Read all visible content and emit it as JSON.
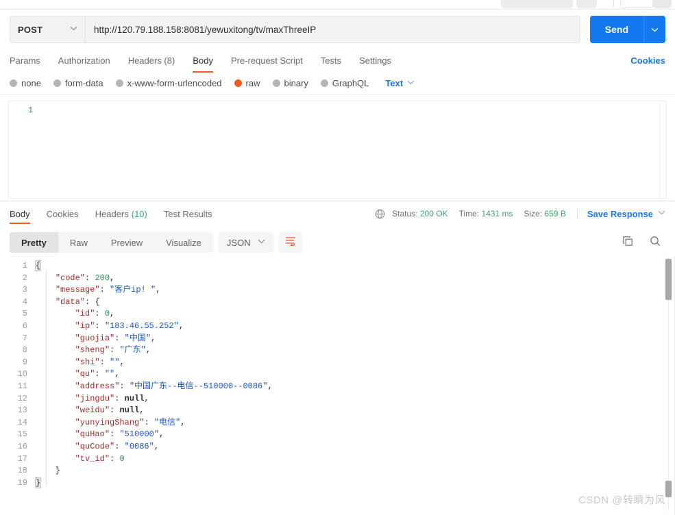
{
  "request": {
    "method": "POST",
    "url": "http://120.79.188.158:8081/yewuxitong/tv/maxThreeIP",
    "send_label": "Send",
    "tabs": [
      {
        "label": "Params",
        "active": false
      },
      {
        "label": "Authorization",
        "active": false
      },
      {
        "label": "Headers (8)",
        "active": false
      },
      {
        "label": "Body",
        "active": true
      },
      {
        "label": "Pre-request Script",
        "active": false
      },
      {
        "label": "Tests",
        "active": false
      },
      {
        "label": "Settings",
        "active": false
      }
    ],
    "cookies_label": "Cookies",
    "body_types": [
      {
        "label": "none",
        "selected": false
      },
      {
        "label": "form-data",
        "selected": false
      },
      {
        "label": "x-www-form-urlencoded",
        "selected": false
      },
      {
        "label": "raw",
        "selected": true
      },
      {
        "label": "binary",
        "selected": false
      },
      {
        "label": "GraphQL",
        "selected": false
      }
    ],
    "raw_format": "Text",
    "editor_line_number": "1",
    "editor_value": ""
  },
  "response": {
    "tabs": [
      {
        "label": "Body",
        "count": "",
        "active": true
      },
      {
        "label": "Cookies",
        "count": "",
        "active": false
      },
      {
        "label": "Headers",
        "count": "(10)",
        "active": false
      },
      {
        "label": "Test Results",
        "count": "",
        "active": false
      }
    ],
    "status_label": "Status:",
    "status_value": "200 OK",
    "time_label": "Time:",
    "time_value": "1431 ms",
    "size_label": "Size:",
    "size_value": "659 B",
    "save_response_label": "Save Response",
    "view_modes": [
      {
        "label": "Pretty",
        "active": true
      },
      {
        "label": "Raw",
        "active": false
      },
      {
        "label": "Preview",
        "active": false
      },
      {
        "label": "Visualize",
        "active": false
      }
    ],
    "format": "JSON",
    "lines": [
      {
        "n": "1",
        "indent": 0,
        "tokens": [
          {
            "t": "brace",
            "v": "{"
          }
        ]
      },
      {
        "n": "2",
        "indent": 1,
        "tokens": [
          {
            "t": "k",
            "v": "\"code\""
          },
          {
            "t": "p",
            "v": ": "
          },
          {
            "t": "n",
            "v": "200"
          },
          {
            "t": "p",
            "v": ","
          }
        ]
      },
      {
        "n": "3",
        "indent": 1,
        "tokens": [
          {
            "t": "k",
            "v": "\"message\""
          },
          {
            "t": "p",
            "v": ": "
          },
          {
            "t": "s",
            "v": "\"客户ip! \""
          },
          {
            "t": "p",
            "v": ","
          }
        ]
      },
      {
        "n": "4",
        "indent": 1,
        "tokens": [
          {
            "t": "k",
            "v": "\"data\""
          },
          {
            "t": "p",
            "v": ": "
          },
          {
            "t": "p",
            "v": "{"
          }
        ]
      },
      {
        "n": "5",
        "indent": 2,
        "tokens": [
          {
            "t": "k",
            "v": "\"id\""
          },
          {
            "t": "p",
            "v": ": "
          },
          {
            "t": "n",
            "v": "0"
          },
          {
            "t": "p",
            "v": ","
          }
        ]
      },
      {
        "n": "6",
        "indent": 2,
        "tokens": [
          {
            "t": "k",
            "v": "\"ip\""
          },
          {
            "t": "p",
            "v": ": "
          },
          {
            "t": "s",
            "v": "\"183.46.55.252\""
          },
          {
            "t": "p",
            "v": ","
          }
        ]
      },
      {
        "n": "7",
        "indent": 2,
        "tokens": [
          {
            "t": "k",
            "v": "\"guojia\""
          },
          {
            "t": "p",
            "v": ": "
          },
          {
            "t": "s",
            "v": "\"中国\""
          },
          {
            "t": "p",
            "v": ","
          }
        ]
      },
      {
        "n": "8",
        "indent": 2,
        "tokens": [
          {
            "t": "k",
            "v": "\"sheng\""
          },
          {
            "t": "p",
            "v": ": "
          },
          {
            "t": "s",
            "v": "\"广东\""
          },
          {
            "t": "p",
            "v": ","
          }
        ]
      },
      {
        "n": "9",
        "indent": 2,
        "tokens": [
          {
            "t": "k",
            "v": "\"shi\""
          },
          {
            "t": "p",
            "v": ": "
          },
          {
            "t": "s",
            "v": "\"\""
          },
          {
            "t": "p",
            "v": ","
          }
        ]
      },
      {
        "n": "10",
        "indent": 2,
        "tokens": [
          {
            "t": "k",
            "v": "\"qu\""
          },
          {
            "t": "p",
            "v": ": "
          },
          {
            "t": "s",
            "v": "\"\""
          },
          {
            "t": "p",
            "v": ","
          }
        ]
      },
      {
        "n": "11",
        "indent": 2,
        "tokens": [
          {
            "t": "k",
            "v": "\"address\""
          },
          {
            "t": "p",
            "v": ": "
          },
          {
            "t": "s",
            "v": "\"中国广东--电信--510000--0086\""
          },
          {
            "t": "p",
            "v": ","
          }
        ]
      },
      {
        "n": "12",
        "indent": 2,
        "tokens": [
          {
            "t": "k",
            "v": "\"jingdu\""
          },
          {
            "t": "p",
            "v": ": "
          },
          {
            "t": "nul",
            "v": "null"
          },
          {
            "t": "p",
            "v": ","
          }
        ]
      },
      {
        "n": "13",
        "indent": 2,
        "tokens": [
          {
            "t": "k",
            "v": "\"weidu\""
          },
          {
            "t": "p",
            "v": ": "
          },
          {
            "t": "nul",
            "v": "null"
          },
          {
            "t": "p",
            "v": ","
          }
        ]
      },
      {
        "n": "14",
        "indent": 2,
        "tokens": [
          {
            "t": "k",
            "v": "\"yunyingShang\""
          },
          {
            "t": "p",
            "v": ": "
          },
          {
            "t": "s",
            "v": "\"电信\""
          },
          {
            "t": "p",
            "v": ","
          }
        ]
      },
      {
        "n": "15",
        "indent": 2,
        "tokens": [
          {
            "t": "k",
            "v": "\"quHao\""
          },
          {
            "t": "p",
            "v": ": "
          },
          {
            "t": "s",
            "v": "\"510000\""
          },
          {
            "t": "p",
            "v": ","
          }
        ]
      },
      {
        "n": "16",
        "indent": 2,
        "tokens": [
          {
            "t": "k",
            "v": "\"quCode\""
          },
          {
            "t": "p",
            "v": ": "
          },
          {
            "t": "s",
            "v": "\"0086\""
          },
          {
            "t": "p",
            "v": ","
          }
        ]
      },
      {
        "n": "17",
        "indent": 2,
        "tokens": [
          {
            "t": "k",
            "v": "\"tv_id\""
          },
          {
            "t": "p",
            "v": ": "
          },
          {
            "t": "n",
            "v": "0"
          }
        ]
      },
      {
        "n": "18",
        "indent": 1,
        "tokens": [
          {
            "t": "p",
            "v": "}"
          }
        ]
      },
      {
        "n": "19",
        "indent": 0,
        "tokens": [
          {
            "t": "brace",
            "v": "}"
          }
        ]
      }
    ],
    "parsed_json": {
      "code": 200,
      "message": "客户ip! ",
      "data": {
        "id": 0,
        "ip": "183.46.55.252",
        "guojia": "中国",
        "sheng": "广东",
        "shi": "",
        "qu": "",
        "address": "中国广东--电信--510000--0086",
        "jingdu": null,
        "weidu": null,
        "yunyingShang": "电信",
        "quHao": "510000",
        "quCode": "0086",
        "tv_id": 0
      }
    }
  },
  "watermark": "CSDN @转瞬为风",
  "colors": {
    "accent_orange": "#ef5b25",
    "link_blue": "#1478f0",
    "status_green": "#3aa76d",
    "json_key": "#a52a2a",
    "json_string": "#1a56c4",
    "json_number": "#2e8b57"
  }
}
